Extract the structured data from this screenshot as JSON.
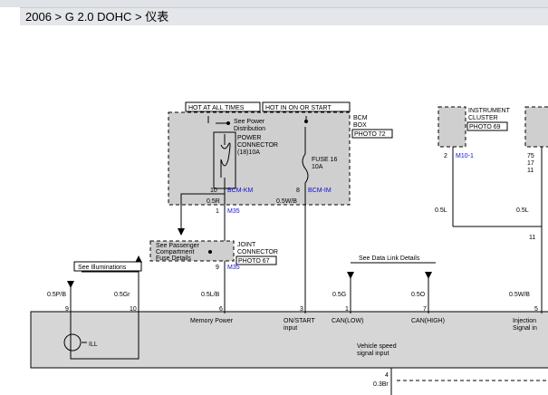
{
  "breadcrumb": "2006 > G 2.0 DOHC > 仪表",
  "diagram": {
    "boxes": {
      "hot_all_times": "HOT AT ALL TIMES",
      "hot_in_on_start": "HOT IN ON OR START",
      "see_power_1": "See Power",
      "see_power_2": "Distribution",
      "power_connector_1": "POWER",
      "power_connector_2": "CONNECTOR",
      "power_connector_3": "(18)10A",
      "fuse_1": "FUSE 16",
      "fuse_2": "10A",
      "bcm_box_1": "BCM",
      "bcm_box_2": "BOX",
      "bcm_photo": "PHOTO 72",
      "instrument_1": "INSTRUMENT",
      "instrument_2": "CLUSTER",
      "instrument_photo": "PHOTO 69",
      "see_passenger_1": "See Passenger",
      "see_passenger_2": "Compartment",
      "see_passenger_3": "Fuse Details",
      "joint_connector_1": "JOINT",
      "joint_connector_2": "CONNECTOR",
      "joint_photo": "PHOTO 67",
      "see_illuminations": "See Illuminations",
      "see_data_link": "See Data Link Details",
      "ill_label": "ILL"
    },
    "wires": {
      "pin_10": "10",
      "bcm_km": "BCM-KM",
      "wire_05r": "0.5R",
      "pin_8": "8",
      "bcm_im": "BCM-IM",
      "wire_05wb": "0.5W/B",
      "pin_1": "1",
      "m35_a": "M35",
      "pin_9": "9",
      "m35_b": "M35",
      "pin_2": "2",
      "m10_1": "M10-1",
      "pin_75": "75",
      "pin_17": "17",
      "pin_11": "11",
      "wire_05l_a": "0.5L",
      "wire_05l_b": "0.5L",
      "pin_11b": "11",
      "wire_05pb": "0.5P/B",
      "wire_05gr": "0.5Gr",
      "wire_05lb": "0.5L/B",
      "wire_05g": "0.5G",
      "wire_05o": "0.5O",
      "wire_05wb_r": "0.5W/B",
      "cpin_9": "9",
      "cpin_10": "10",
      "cpin_6": "6",
      "cpin_3": "3",
      "cpin_1": "1",
      "cpin_7": "7",
      "cpin_5": "5",
      "pin_4": "4",
      "wire_03br": "0.3Br"
    },
    "cluster": {
      "memory_power": "Memory Power",
      "on_start_1": "ON/START",
      "on_start_2": "input",
      "can_low": "CAN(LOW)",
      "can_high": "CAN(HIGH)",
      "injection_1": "Injection",
      "injection_2": "Signal in",
      "vss_1": "Vehicle speed",
      "vss_2": "signal input"
    }
  },
  "colors": {
    "breadcrumb_bg": "#e4e6ea",
    "shaded_box": "#cfcfcf",
    "cluster_fill": "#d6d6d6",
    "connector_id": "#1010d0"
  }
}
